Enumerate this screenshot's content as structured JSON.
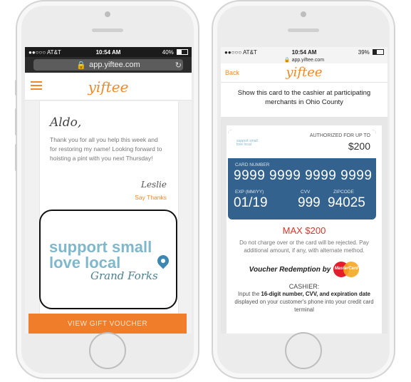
{
  "colors": {
    "brand_orange": "#ef7d2a",
    "card_blue": "#34628e",
    "banner_blue": "#7fb8cb",
    "max_red": "#d9352b"
  },
  "left_phone": {
    "status": {
      "carrier": "●●○○○ AT&T",
      "time": "10:54 AM",
      "battery": "40%",
      "battery_level": 0.4
    },
    "url": "app.yiftee.com",
    "menu_icon": "hamburger-icon",
    "logo": "yiftee",
    "note": {
      "greeting": "Aldo,",
      "message": "Thank you for all you help this week and for restoring my name! Looking forward to hoisting a pint with you next Thursday!",
      "signature": "Leslie",
      "say_thanks": "Say Thanks"
    },
    "banner": {
      "line1": "support small",
      "line2": "love local",
      "line3": "Grand Forks",
      "icon": "location-pin-icon"
    },
    "cta": "VIEW GIFT VOUCHER"
  },
  "right_phone": {
    "status": {
      "carrier": "●●○○○ AT&T",
      "time": "10:54 AM",
      "battery": "39%",
      "battery_level": 0.39
    },
    "url": "app.yiftee.com",
    "back": "Back",
    "logo": "yiftee",
    "instruction": "Show this card to the cashier at participating merchants in Ohio County",
    "card": {
      "authorized_label": "AUTHORIZED FOR UP TO",
      "authorized_amount": "$200",
      "number_label": "CARD NUMBER",
      "number": "9999 9999 9999 9999",
      "exp_label": "EXP (MM/YY)",
      "exp": "01/19",
      "cvv_label": "CVV",
      "cvv": "999",
      "zip_label": "ZIPCODE",
      "zip": "94025"
    },
    "max": "MAX $200",
    "disclaimer": "Do not charge over or the card will be rejected. Pay additional amount, if any, with alternate method.",
    "voucher_label": "Voucher Redemption by",
    "mastercard": "MasterCard",
    "cashier_title": "CASHIER:",
    "cashier_text_pre": "Input the ",
    "cashier_text_bold1": "16-digit number, CVV, and expiration date",
    "cashier_text_post": " displayed on your customer's phone into your credit card terminal"
  }
}
